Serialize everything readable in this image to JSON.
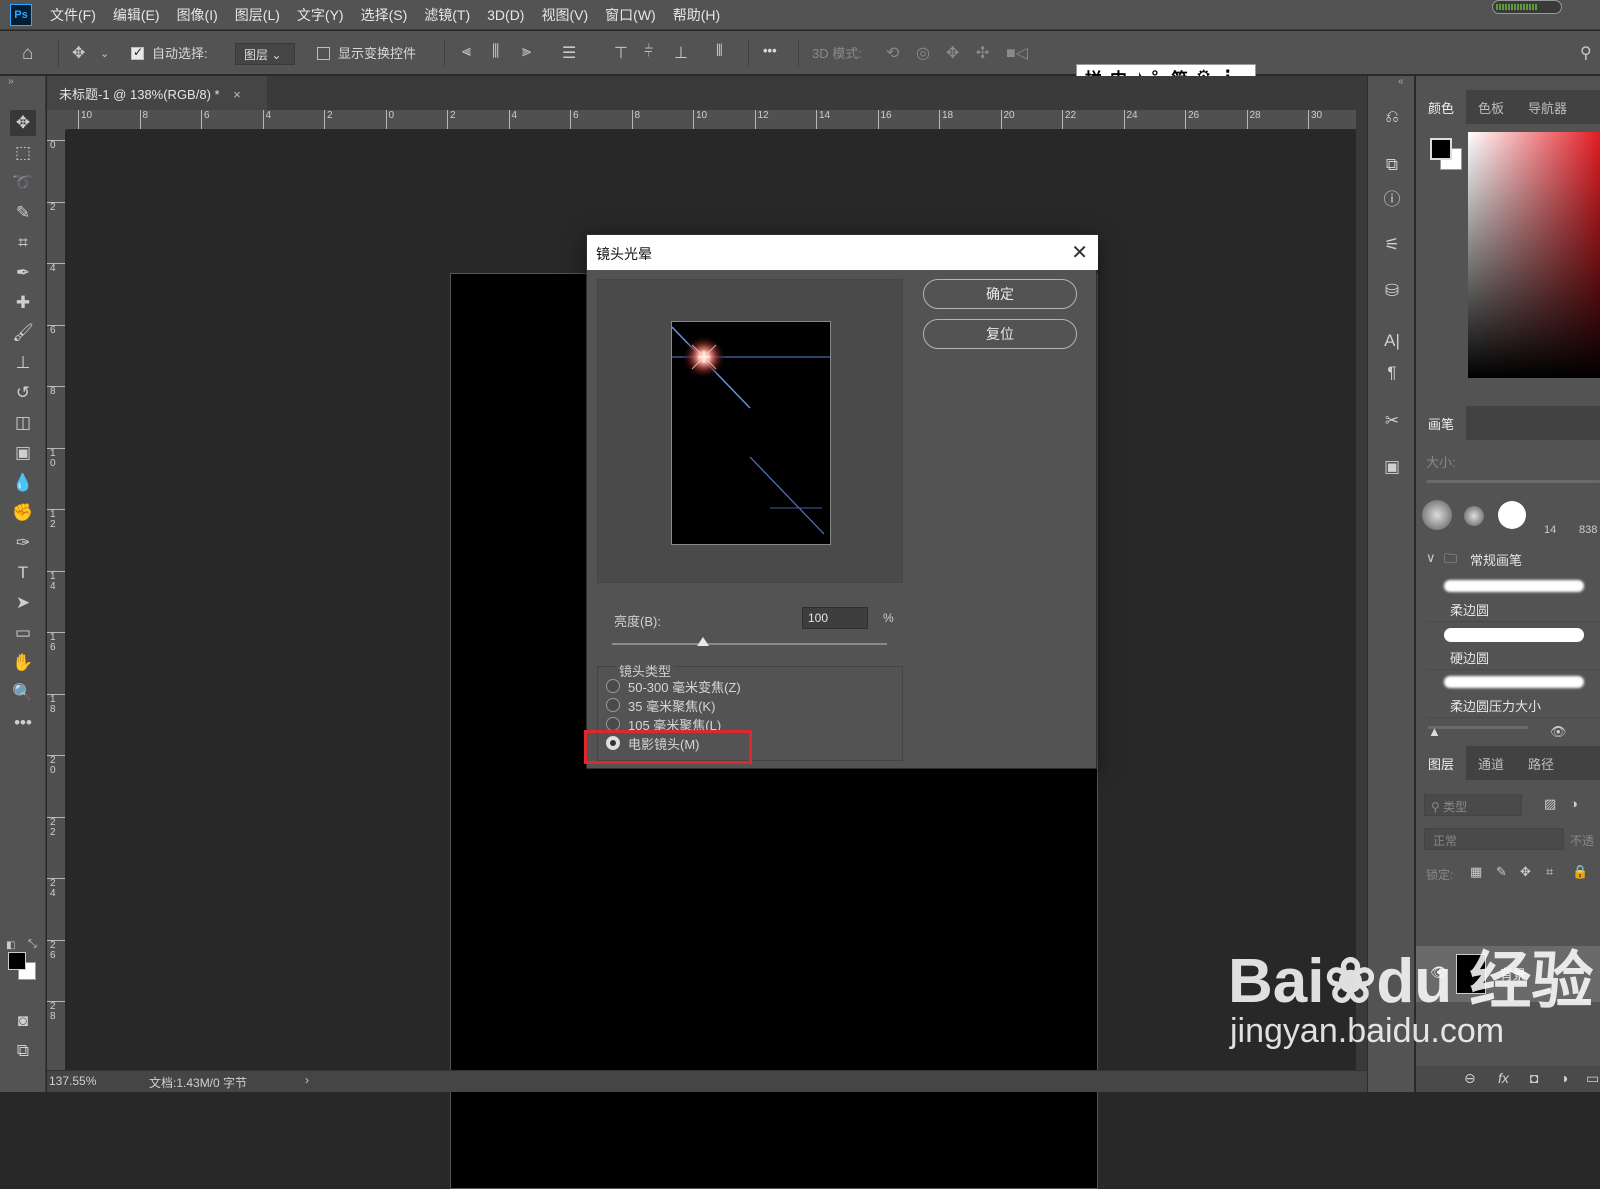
{
  "app": {
    "logo": "Ps"
  },
  "menu": [
    "文件(F)",
    "编辑(E)",
    "图像(I)",
    "图层(L)",
    "文字(Y)",
    "选择(S)",
    "滤镜(T)",
    "3D(D)",
    "视图(V)",
    "窗口(W)",
    "帮助(H)"
  ],
  "options": {
    "auto_select_label": "自动选择:",
    "auto_select_checked": true,
    "auto_select_target": "图层",
    "show_transform_label": "显示变换控件",
    "show_transform_checked": false,
    "more": "•••",
    "mode_3d_label": "3D 模式:"
  },
  "ime": {
    "items": [
      "拼",
      "中",
      "♪",
      "°,",
      "简",
      "⚙",
      "⋮"
    ]
  },
  "document": {
    "tab_title": "未标题-1 @ 138%(RGB/8) *",
    "tab_close": "×",
    "hruler_labels": [
      "10",
      "8",
      "6",
      "4",
      "2",
      "0",
      "2",
      "4",
      "6",
      "8",
      "10",
      "12",
      "14",
      "16",
      "18",
      "20",
      "22",
      "24",
      "26",
      "28",
      "30"
    ],
    "vruler_labels": [
      "0",
      "2",
      "4",
      "6",
      "8",
      "10",
      "12",
      "14",
      "16",
      "18",
      "20",
      "22",
      "24",
      "26",
      "28"
    ],
    "zoom": "137.55%",
    "doc_info": "文档:1.43M/0 字节",
    "status_arrow": "›"
  },
  "toolbar": {
    "icons": [
      "move-icon",
      "marquee-icon",
      "lasso-icon",
      "quick-select-icon",
      "crop-icon",
      "eyedropper-icon",
      "healing-brush-icon",
      "brush-icon",
      "clone-stamp-icon",
      "history-brush-icon",
      "eraser-icon",
      "gradient-icon",
      "blur-icon",
      "dodge-icon",
      "pen-icon",
      "type-icon",
      "path-select-icon",
      "rectangle-icon",
      "hand-icon",
      "zoom-icon",
      "more-tools-icon"
    ],
    "glyphs": [
      "✥",
      "⬚",
      "➰",
      "✎",
      "⌗",
      "✒",
      "✚",
      "🖌",
      "⊥",
      "↺",
      "◫",
      "▣",
      "💧",
      "✊",
      "✑",
      "T",
      "➤",
      "▭",
      "✋",
      "🔍",
      "•••"
    ],
    "foreground_color": "#000000",
    "background_color": "#ffffff"
  },
  "dock": {
    "icons": [
      "history-icon",
      "3d-icon",
      "info-icon",
      "brush-settings-icon",
      "clone-source-icon",
      "character-icon",
      "paragraph-icon",
      "tools-icon",
      "libraries-icon"
    ],
    "glyphs": [
      "⎌",
      "⧉",
      "ⓘ",
      "⚟",
      "⛁",
      "A|",
      "¶",
      "✂",
      "▣"
    ],
    "collapse": "«"
  },
  "color_panel": {
    "tabs": [
      "颜色",
      "色板",
      "导航器"
    ],
    "foreground": "#000000",
    "background": "#ffffff",
    "hue_color": "#e31c23"
  },
  "brush_panel": {
    "tab": "画笔",
    "size_label": "大小:",
    "tip_sizes": [
      "14",
      "838"
    ],
    "group_name": "常规画笔",
    "group_chevron": "∨",
    "brushes": [
      "柔边圆",
      "硬边圆",
      "柔边圆压力大小"
    ]
  },
  "layers_panel": {
    "tabs": [
      "图层",
      "通道",
      "路径"
    ],
    "filter_placeholder": "类型",
    "blend_mode": "正常",
    "opacity_label": "不透",
    "lock_label": "锁定:",
    "layer_name": "背景",
    "footer": [
      "⊖",
      "fx",
      "◘",
      "◑",
      "▭"
    ]
  },
  "dialog": {
    "title": "镜头光晕",
    "close": "✕",
    "ok": "确定",
    "reset": "复位",
    "brightness_label": "亮度(B):",
    "brightness_value": "100",
    "brightness_unit": "%",
    "brightness_level": 0.33,
    "lens_type_title": "镜头类型",
    "lens_types": [
      "50-300 毫米变焦(Z)",
      "35 毫米聚焦(K)",
      "105 毫米聚焦(L)",
      "电影镜头(M)"
    ],
    "selected_lens_index": 3,
    "highlight_color": "#e0272b"
  },
  "watermark": {
    "logo": "Bai❀du 经验",
    "url": "jingyan.baidu.com"
  }
}
